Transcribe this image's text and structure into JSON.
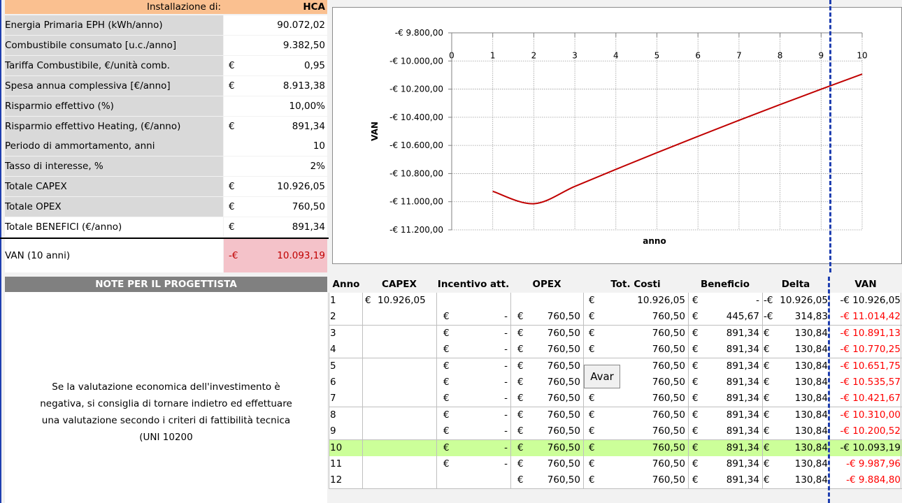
{
  "params": {
    "install_label": "Installazione di:",
    "install_value": "HCA",
    "currency": "€",
    "rows": [
      {
        "label": "Energia Primaria EPH (kWh/anno)",
        "currency": "",
        "value": "90.072,02"
      },
      {
        "label": "Combustibile consumato [u.c./anno]",
        "currency": "",
        "value": "9.382,50"
      },
      {
        "label": "Tariffa Combustibile, €/unità comb.",
        "currency": "€",
        "value": "0,95"
      },
      {
        "label": "Spesa annua complessiva [€/anno]",
        "currency": "€",
        "value": "8.913,38"
      },
      {
        "label": "Risparmio effettivo (%)",
        "currency": "",
        "value": "10,00%"
      },
      {
        "label": "Risparmio effettivo Heating, (€/anno)",
        "currency": "€",
        "value": "891,34"
      },
      {
        "label": "Periodo di ammortamento, anni",
        "currency": "",
        "value": "10"
      },
      {
        "label": "Tasso di interesse, %",
        "currency": "",
        "value": "2%"
      },
      {
        "label": "Totale CAPEX",
        "currency": "€",
        "value": "10.926,05"
      },
      {
        "label": "Totale OPEX",
        "currency": "€",
        "value": "760,50"
      },
      {
        "label": "Totale BENEFICI (€/anno)",
        "currency": "€",
        "value": "891,34"
      }
    ],
    "van_label": "VAN (10 anni)",
    "van_currency": "-€",
    "van_value": "10.093,19"
  },
  "notes": {
    "title": "NOTE PER IL PROGETTISTA",
    "line1": "Se la valutazione economica dell'investimento è",
    "line2": "negativa, si consiglia di tornare indietro ed effettuare",
    "line3": "una valutazione secondo i criteri di fattibilità tecnica",
    "line4": "(UNI 10200"
  },
  "table": {
    "headers": [
      "Anno",
      "CAPEX",
      "Incentivo att.",
      "OPEX",
      "Tot. Costi",
      "Beneficio",
      "Delta",
      "VAN"
    ],
    "rows": [
      {
        "anno": "1",
        "capex_cur": "€",
        "capex": "10.926,05",
        "inc_cur": "",
        "inc": "",
        "opex_cur": "",
        "opex": "",
        "tot_cur": "€",
        "tot": "10.926,05",
        "ben_cur": "€",
        "ben": "-",
        "delta_cur": "-€",
        "delta": "10.926,05",
        "van": "-€ 10.926,05",
        "van_red": false
      },
      {
        "anno": "2",
        "capex_cur": "",
        "capex": "",
        "inc_cur": "€",
        "inc": "-",
        "opex_cur": "€",
        "opex": "760,50",
        "tot_cur": "€",
        "tot": "760,50",
        "ben_cur": "€",
        "ben": "445,67",
        "delta_cur": "-€",
        "delta": "314,83",
        "van": "-€ 11.014,42",
        "van_red": true
      },
      {
        "anno": "3",
        "capex_cur": "",
        "capex": "",
        "inc_cur": "€",
        "inc": "-",
        "opex_cur": "€",
        "opex": "760,50",
        "tot_cur": "€",
        "tot": "760,50",
        "ben_cur": "€",
        "ben": "891,34",
        "delta_cur": "€",
        "delta": "130,84",
        "van": "-€ 10.891,13",
        "van_red": true
      },
      {
        "anno": "4",
        "capex_cur": "",
        "capex": "",
        "inc_cur": "€",
        "inc": "-",
        "opex_cur": "€",
        "opex": "760,50",
        "tot_cur": "€",
        "tot": "760,50",
        "ben_cur": "€",
        "ben": "891,34",
        "delta_cur": "€",
        "delta": "130,84",
        "van": "-€ 10.770,25",
        "van_red": true
      },
      {
        "anno": "5",
        "capex_cur": "",
        "capex": "",
        "inc_cur": "€",
        "inc": "-",
        "opex_cur": "€",
        "opex": "760,50",
        "tot_cur": "",
        "tot": "760,50",
        "ben_cur": "€",
        "ben": "891,34",
        "delta_cur": "€",
        "delta": "130,84",
        "van": "-€ 10.651,75",
        "van_red": true
      },
      {
        "anno": "6",
        "capex_cur": "",
        "capex": "",
        "inc_cur": "€",
        "inc": "-",
        "opex_cur": "€",
        "opex": "760,50",
        "tot_cur": "",
        "tot": "760,50",
        "ben_cur": "€",
        "ben": "891,34",
        "delta_cur": "€",
        "delta": "130,84",
        "van": "-€ 10.535,57",
        "van_red": true
      },
      {
        "anno": "7",
        "capex_cur": "",
        "capex": "",
        "inc_cur": "€",
        "inc": "-",
        "opex_cur": "€",
        "opex": "760,50",
        "tot_cur": "€",
        "tot": "760,50",
        "ben_cur": "€",
        "ben": "891,34",
        "delta_cur": "€",
        "delta": "130,84",
        "van": "-€ 10.421,67",
        "van_red": true
      },
      {
        "anno": "8",
        "capex_cur": "",
        "capex": "",
        "inc_cur": "€",
        "inc": "-",
        "opex_cur": "€",
        "opex": "760,50",
        "tot_cur": "€",
        "tot": "760,50",
        "ben_cur": "€",
        "ben": "891,34",
        "delta_cur": "€",
        "delta": "130,84",
        "van": "-€ 10.310,00",
        "van_red": true
      },
      {
        "anno": "9",
        "capex_cur": "",
        "capex": "",
        "inc_cur": "€",
        "inc": "-",
        "opex_cur": "€",
        "opex": "760,50",
        "tot_cur": "€",
        "tot": "760,50",
        "ben_cur": "€",
        "ben": "891,34",
        "delta_cur": "€",
        "delta": "130,84",
        "van": "-€ 10.200,52",
        "van_red": true
      },
      {
        "anno": "10",
        "capex_cur": "",
        "capex": "",
        "inc_cur": "€",
        "inc": "-",
        "opex_cur": "€",
        "opex": "760,50",
        "tot_cur": "€",
        "tot": "760,50",
        "ben_cur": "€",
        "ben": "891,34",
        "delta_cur": "€",
        "delta": "130,84",
        "van": "-€ 10.093,19",
        "van_red": false
      },
      {
        "anno": "11",
        "capex_cur": "",
        "capex": "",
        "inc_cur": "€",
        "inc": "-",
        "opex_cur": "€",
        "opex": "760,50",
        "tot_cur": "€",
        "tot": "760,50",
        "ben_cur": "€",
        "ben": "891,34",
        "delta_cur": "€",
        "delta": "130,84",
        "van": "-€ 9.987,96",
        "van_red": true
      },
      {
        "anno": "12",
        "capex_cur": "",
        "capex": "",
        "inc_cur": "",
        "inc": "",
        "opex_cur": "€",
        "opex": "760,50",
        "tot_cur": "€",
        "tot": "760,50",
        "ben_cur": "€",
        "ben": "891,34",
        "delta_cur": "€",
        "delta": "130,84",
        "van": "-€ 9.884,80",
        "van_red": true
      }
    ]
  },
  "avar_button": "Avar",
  "colors": {
    "install_bg": "#fac090",
    "van_bg": "#f4c2c9",
    "highlight_row": "#ccff99",
    "chart_line": "#c00000",
    "negative_text": "#ff0000",
    "page_break": "#1f3fb0"
  },
  "chart_data": {
    "type": "line",
    "title": "",
    "xlabel": "anno",
    "ylabel": "VAN",
    "x_ticks": [
      "0",
      "1",
      "2",
      "3",
      "4",
      "5",
      "6",
      "7",
      "8",
      "9",
      "10"
    ],
    "y_ticks": [
      "-€ 9.800,00",
      "-€ 10.000,00",
      "-€ 10.200,00",
      "-€ 10.400,00",
      "-€ 10.600,00",
      "-€ 10.800,00",
      "-€ 11.000,00",
      "-€ 11.200,00"
    ],
    "y_tick_values": [
      -9800,
      -10000,
      -10200,
      -10400,
      -10600,
      -10800,
      -11000,
      -11200
    ],
    "xlim": [
      0,
      10
    ],
    "ylim": [
      -11200,
      -9800
    ],
    "series": [
      {
        "x": [
          1,
          2,
          3,
          4,
          5,
          6,
          7,
          8,
          9,
          10
        ],
        "values": [
          -10926.05,
          -11014.42,
          -10891.13,
          -10770.25,
          -10651.75,
          -10535.57,
          -10421.67,
          -10310.0,
          -10200.52,
          -10093.19
        ]
      }
    ]
  }
}
